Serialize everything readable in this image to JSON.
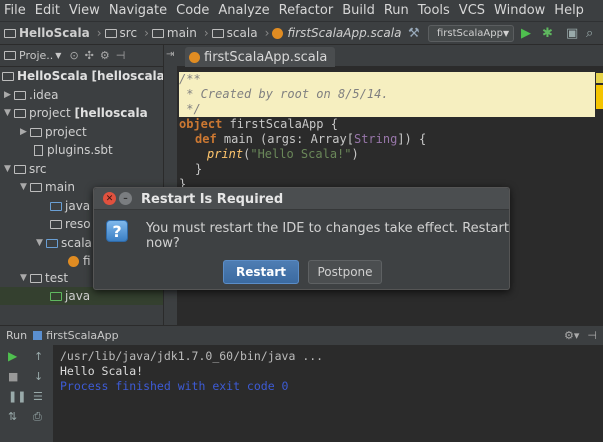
{
  "menu": [
    "File",
    "Edit",
    "View",
    "Navigate",
    "Code",
    "Analyze",
    "Refactor",
    "Build",
    "Run",
    "Tools",
    "VCS",
    "Window",
    "Help"
  ],
  "navbar": {
    "crumbs": [
      "HelloScala",
      "src",
      "main",
      "scala",
      "firstScalaApp.scala"
    ],
    "run_config": "firstScalaApp"
  },
  "project_panel": {
    "title": "Proje..",
    "tree": [
      {
        "label": "HelloScala",
        "suffix": "[helloscala"
      },
      {
        "label": ".idea"
      },
      {
        "label": "project",
        "suffix": "[helloscala"
      },
      {
        "label": "project"
      },
      {
        "label": "plugins.sbt"
      },
      {
        "label": "src"
      },
      {
        "label": "main"
      },
      {
        "label": "java"
      },
      {
        "label": "reso"
      },
      {
        "label": "scala"
      },
      {
        "label": "fi"
      },
      {
        "label": "test"
      },
      {
        "label": "java"
      }
    ]
  },
  "editor": {
    "tab": "firstScalaApp.scala",
    "code": {
      "l1": "/**",
      "l2": " * Created by root on 8/5/14.",
      "l3": " */",
      "l4_kw": "object",
      "l4_rest": " firstScalaApp {",
      "l5_kw": "def",
      "l5_a": " main (args: Array[",
      "l5_type": "String",
      "l5_b": "]) {",
      "l6_fn": "print",
      "l6_open": "(",
      "l6_str": "\"Hello Scala!\"",
      "l6_close": ")",
      "l7": "}",
      "l8": "}"
    }
  },
  "dialog": {
    "title": "Restart Is Required",
    "message": "You must restart the IDE to changes take effect. Restart now?",
    "primary": "Restart",
    "secondary": "Postpone"
  },
  "run_panel": {
    "label": "Run",
    "config": "firstScalaApp",
    "console": [
      "/usr/lib/java/jdk1.7.0_60/bin/java ...",
      "Hello Scala!",
      "Process finished with exit code 0"
    ]
  },
  "colors": {
    "background": "#2b2b2b",
    "panel": "#3c3f41",
    "keyword": "#cc7832",
    "string": "#6a8759",
    "accent_blue": "#3b6aa0",
    "console_exit": "#3d5bd6"
  }
}
